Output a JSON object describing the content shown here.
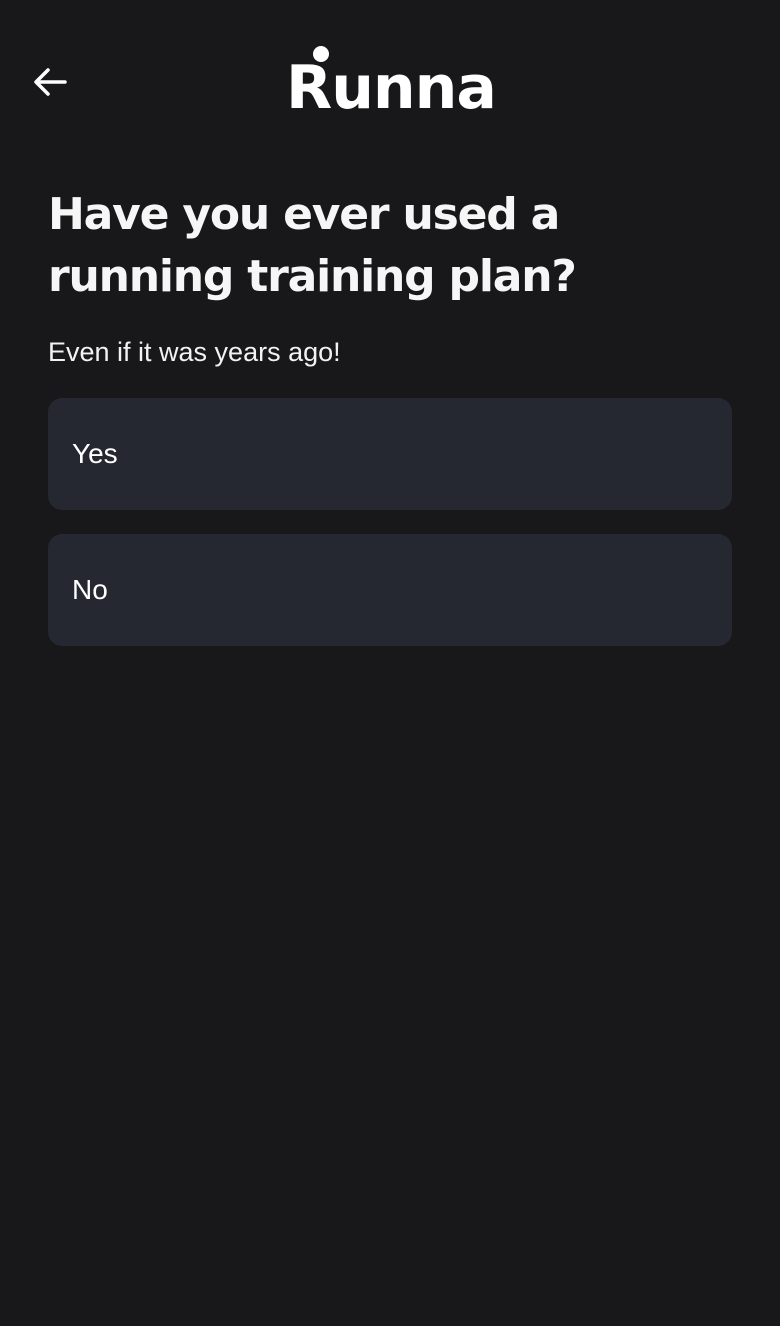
{
  "header": {
    "back_icon": "arrow-left-icon",
    "logo_text": "Runna"
  },
  "question": {
    "title": "Have you ever used a running training plan?",
    "subtitle": "Even if it was years ago!"
  },
  "options": [
    {
      "label": "Yes"
    },
    {
      "label": "No"
    }
  ],
  "colors": {
    "background": "#18171a",
    "option_background": "#252830",
    "text": "#ffffff"
  }
}
